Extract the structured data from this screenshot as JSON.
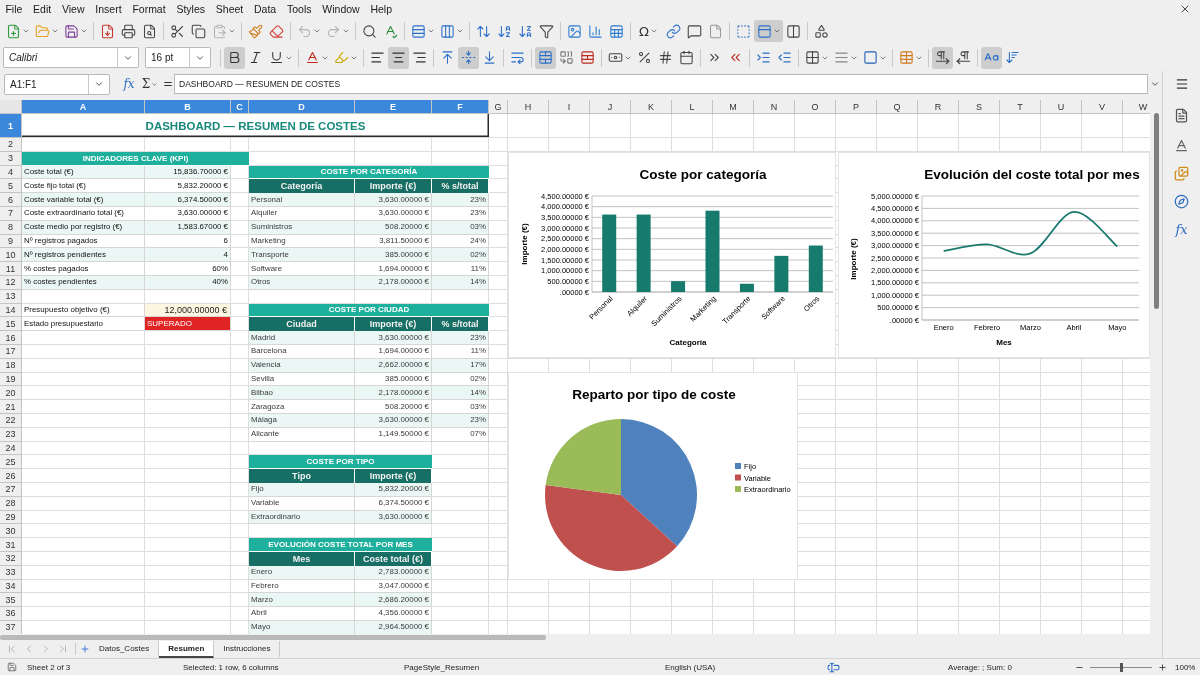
{
  "menu": [
    "File",
    "Edit",
    "View",
    "Insert",
    "Format",
    "Styles",
    "Sheet",
    "Data",
    "Tools",
    "Window",
    "Help"
  ],
  "standard_toolbar": {
    "paste_available": false,
    "undo_available": false,
    "redo_available": false,
    "special_character_glyph": "Ω",
    "freeze_panes": true
  },
  "formatting_toolbar": {
    "font_name": "Calibri",
    "font_size": "16 pt",
    "bold": true,
    "italic": false,
    "underline": false,
    "align_left": false,
    "align_center": true,
    "align_right": false,
    "align_top": false,
    "align_middle": true,
    "align_bottom": false,
    "merge_and_center": true,
    "paragraph_ltr": true,
    "paragraph_rtl": false,
    "text_horizontal": true,
    "text_vertical": false
  },
  "formula_bar": {
    "name_box": "A1:F1",
    "function_glyph": "fx",
    "sum_glyph": "Σ",
    "formula_glyph": "=",
    "content": "DASHBOARD — RESUMEN DE COSTES"
  },
  "sheet": {
    "columns": [
      {
        "label": "A",
        "selected": true
      },
      {
        "label": "B",
        "selected": true
      },
      {
        "label": "C",
        "selected": true
      },
      {
        "label": "D",
        "selected": true
      },
      {
        "label": "E",
        "selected": true
      },
      {
        "label": "F",
        "selected": true
      },
      {
        "label": "G",
        "selected": false
      },
      {
        "label": "H",
        "selected": false
      },
      {
        "label": "I",
        "selected": false
      },
      {
        "label": "J",
        "selected": false
      },
      {
        "label": "K",
        "selected": false
      },
      {
        "label": "L",
        "selected": false
      },
      {
        "label": "M",
        "selected": false
      },
      {
        "label": "N",
        "selected": false
      },
      {
        "label": "O",
        "selected": false
      },
      {
        "label": "P",
        "selected": false
      },
      {
        "label": "Q",
        "selected": false
      },
      {
        "label": "R",
        "selected": false
      },
      {
        "label": "S",
        "selected": false
      },
      {
        "label": "T",
        "selected": false
      },
      {
        "label": "U",
        "selected": false
      },
      {
        "label": "V",
        "selected": false
      },
      {
        "label": "W",
        "selected": false
      }
    ],
    "rows": [
      {
        "label": "1",
        "selected": true
      },
      {
        "label": "2",
        "selected": false
      },
      {
        "label": "3",
        "selected": false
      },
      {
        "label": "4",
        "selected": false
      },
      {
        "label": "5",
        "selected": false
      },
      {
        "label": "6",
        "selected": false
      },
      {
        "label": "7",
        "selected": false
      },
      {
        "label": "8",
        "selected": false
      },
      {
        "label": "9",
        "selected": false
      },
      {
        "label": "10",
        "selected": false
      },
      {
        "label": "11",
        "selected": false
      },
      {
        "label": "12",
        "selected": false
      },
      {
        "label": "13",
        "selected": false
      },
      {
        "label": "14",
        "selected": false
      },
      {
        "label": "15",
        "selected": false
      },
      {
        "label": "16",
        "selected": false
      },
      {
        "label": "17",
        "selected": false
      },
      {
        "label": "18",
        "selected": false
      },
      {
        "label": "19",
        "selected": false
      },
      {
        "label": "20",
        "selected": false
      },
      {
        "label": "21",
        "selected": false
      },
      {
        "label": "22",
        "selected": false
      },
      {
        "label": "23",
        "selected": false
      },
      {
        "label": "24",
        "selected": false
      },
      {
        "label": "25",
        "selected": false
      },
      {
        "label": "26",
        "selected": false
      },
      {
        "label": "27",
        "selected": false
      },
      {
        "label": "28",
        "selected": false
      },
      {
        "label": "29",
        "selected": false
      },
      {
        "label": "30",
        "selected": false
      },
      {
        "label": "31",
        "selected": false
      },
      {
        "label": "32",
        "selected": false
      },
      {
        "label": "33",
        "selected": false
      },
      {
        "label": "34",
        "selected": false
      },
      {
        "label": "35",
        "selected": false
      },
      {
        "label": "36",
        "selected": false
      },
      {
        "label": "37",
        "selected": false
      }
    ],
    "title": {
      "text": "DASHBOARD — RESUMEN DE COSTES",
      "selected": true
    },
    "kpi": {
      "title": "INDICADORES CLAVE (KPI)",
      "rows": [
        {
          "label": "Coste total (€)",
          "value": "15,836.70000 €"
        },
        {
          "label": "Coste fijo total (€)",
          "value": "5,832.20000 €"
        },
        {
          "label": "Coste variable total (€)",
          "value": "6,374.50000 €"
        },
        {
          "label": "Coste extraordinario total (€)",
          "value": "3,630.00000 €"
        },
        {
          "label": "Coste medio por registro (€)",
          "value": "1,583.67000 €"
        },
        {
          "label": "Nº registros pagados",
          "value": "6"
        },
        {
          "label": "Nº registros pendientes",
          "value": "4"
        },
        {
          "label": "% costes pagados",
          "value": "60%"
        },
        {
          "label": "% costes pendientes",
          "value": "40%"
        }
      ]
    },
    "budget": {
      "target": {
        "label": "Presupuesto objetivo (€)",
        "value": "12,000.00000 €"
      },
      "status": {
        "label": "Estado presupuestario",
        "value": "SUPERADO"
      }
    },
    "tables": [
      {
        "title": "COSTE POR CATEGORÍA",
        "columns": [
          "Categoría",
          "Importe (€)",
          "% s/total"
        ],
        "rows": [
          [
            "Personal",
            "3,630.00000 €",
            "23%"
          ],
          [
            "Alquiler",
            "3,630.00000 €",
            "23%"
          ],
          [
            "Suministros",
            "508.20000 €",
            "03%"
          ],
          [
            "Marketing",
            "3,811.50000 €",
            "24%"
          ],
          [
            "Transporte",
            "385.00000 €",
            "02%"
          ],
          [
            "Software",
            "1,694.00000 €",
            "11%"
          ],
          [
            "Otros",
            "2,178.00000 €",
            "14%"
          ]
        ]
      },
      {
        "title": "COSTE POR CIUDAD",
        "columns": [
          "Ciudad",
          "Importe (€)",
          "% s/total"
        ],
        "rows": [
          [
            "Madrid",
            "3,630.00000 €",
            "23%"
          ],
          [
            "Barcelona",
            "1,694.00000 €",
            "11%"
          ],
          [
            "Valencia",
            "2,662.00000 €",
            "17%"
          ],
          [
            "Sevilla",
            "385.00000 €",
            "02%"
          ],
          [
            "Bilbao",
            "2,178.00000 €",
            "14%"
          ],
          [
            "Zaragoza",
            "508.20000 €",
            "03%"
          ],
          [
            "Málaga",
            "3,630.00000 €",
            "23%"
          ],
          [
            "Alicante",
            "1,149.50000 €",
            "07%"
          ]
        ]
      },
      {
        "title": "COSTE POR TIPO",
        "columns": [
          "Tipo",
          "Importe (€)"
        ],
        "rows": [
          [
            "Fijo",
            "5,832.20000 €"
          ],
          [
            "Variable",
            "6,374.50000 €"
          ],
          [
            "Extraordinario",
            "3,630.00000 €"
          ]
        ]
      },
      {
        "title": "EVOLUCIÓN COSTE TOTAL POR MES",
        "columns": [
          "Mes",
          "Coste total (€)"
        ],
        "rows": [
          [
            "Enero",
            "2,783.00000 €"
          ],
          [
            "Febrero",
            "3,047.00000 €"
          ],
          [
            "Marzo",
            "2,686.20000 €"
          ],
          [
            "Abril",
            "4,356.00000 €"
          ],
          [
            "Mayo",
            "2,964.50000 €"
          ]
        ]
      }
    ]
  },
  "charts": [
    {
      "chart_data": {
        "type": "bar",
        "title": "Coste por categoría",
        "xlabel": "Categoría",
        "ylabel": "Importe (€)",
        "categories": [
          "Personal",
          "Alquiler",
          "Suministros",
          "Marketing",
          "Transporte",
          "Software",
          "Otros"
        ],
        "series": [
          {
            "color": "#167a6c",
            "values": [
              3630,
              3630,
              508.2,
              3811.5,
              385,
              1694,
              2178
            ]
          }
        ],
        "ylim": [
          0,
          4500
        ],
        "grid": true,
        "yticks": [
          {
            "value": 0,
            "label": ".00000 €"
          },
          {
            "value": 500,
            "label": "500.00000 €"
          },
          {
            "value": 1000,
            "label": "1,000.00000 €"
          },
          {
            "value": 1500,
            "label": "1,500.00000 €"
          },
          {
            "value": 2000,
            "label": "2,000.00000 €"
          },
          {
            "value": 2500,
            "label": "2,500.00000 €"
          },
          {
            "value": 3000,
            "label": "3,000.00000 €"
          },
          {
            "value": 3500,
            "label": "3,500.00000 €"
          },
          {
            "value": 4000,
            "label": "4,000.00000 €"
          },
          {
            "value": 4500,
            "label": "4,500.00000 €"
          }
        ]
      }
    },
    {
      "chart_data": {
        "type": "line",
        "title": "Evolución del coste total por mes",
        "xlabel": "Mes",
        "ylabel": "Importe (€)",
        "categories": [
          "Enero",
          "Febrero",
          "Marzo",
          "Abril",
          "Mayo"
        ],
        "series": [
          {
            "color": "#1a7a6f",
            "values": [
              2783,
              3047,
              2686.2,
              4356,
              2964.5
            ]
          }
        ],
        "ylim": [
          0,
          5000
        ],
        "grid": true,
        "yticks": [
          {
            "value": 0,
            "label": ".00000 €"
          },
          {
            "value": 500,
            "label": "500.00000 €"
          },
          {
            "value": 1000,
            "label": "1,000.00000 €"
          },
          {
            "value": 1500,
            "label": "1,500.00000 €"
          },
          {
            "value": 2000,
            "label": "2,000.00000 €"
          },
          {
            "value": 2500,
            "label": "2,500.00000 €"
          },
          {
            "value": 3000,
            "label": "3,000.00000 €"
          },
          {
            "value": 3500,
            "label": "3,500.00000 €"
          },
          {
            "value": 4000,
            "label": "4,000.00000 €"
          },
          {
            "value": 4500,
            "label": "4,500.00000 €"
          },
          {
            "value": 5000,
            "label": "5,000.00000 €"
          }
        ]
      }
    },
    {
      "chart_data": {
        "type": "pie",
        "title": "Reparto por tipo de coste",
        "categories": [
          "Fijo",
          "Variable",
          "Extraordinario"
        ],
        "values": [
          36.8,
          40.3,
          22.9
        ],
        "colors": [
          "#4f81bd",
          "#c0504d",
          "#9bbb59"
        ],
        "legend": "right"
      }
    }
  ],
  "sheet_tabs": [
    {
      "label": "Datos_Costes",
      "selected": false
    },
    {
      "label": "Resumen",
      "selected": true
    },
    {
      "label": "Instrucciones",
      "selected": false
    }
  ],
  "sidebar": {
    "functions_glyph": "fx"
  },
  "status_bar": {
    "sheet": "Sheet 2 of 3",
    "selection": "Selected: 1 row, 6 columns",
    "page_style": "PageStyle_Resumen",
    "language": "English (USA)",
    "summary": "Average: ; Sum: 0",
    "zoom_slider": {
      "level": 0.5
    },
    "zoom": "100%"
  }
}
